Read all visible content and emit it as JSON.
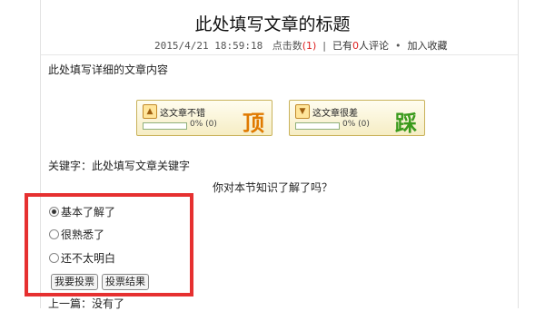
{
  "article": {
    "title": "此处填写文章的标题",
    "date": "2015/4/21 18:59:18",
    "clicks_label": "点击数",
    "clicks_count": "(1)",
    "comments_prefix": "已有",
    "comments_count": "0",
    "comments_suffix": "人评论",
    "favorite_label": "加入收藏",
    "content": "此处填写详细的文章内容"
  },
  "votes": {
    "up": {
      "label": "这文章不错",
      "stat": "0% (0)",
      "big": "顶",
      "big_color": "#e07a00",
      "percent": 0
    },
    "down": {
      "label": "这文章很差",
      "stat": "0% (0)",
      "big": "踩",
      "big_color": "#3a9a1c",
      "percent": 0
    }
  },
  "keywords": "关键字：此处填写文章关键字",
  "poll": {
    "question": "你对本节知识了解了吗？",
    "options": [
      "基本了解了",
      "很熟悉了",
      "还不太明白"
    ],
    "selected_index": 0,
    "vote_button": "我要投票",
    "result_button": "投票结果"
  },
  "nav": {
    "prev": "上一篇：没有了"
  },
  "colors": {
    "highlight": "#e63030",
    "accent_red": "#dd2222"
  },
  "icons": {
    "up": "thumbs-up-icon",
    "down": "thumbs-down-icon"
  }
}
